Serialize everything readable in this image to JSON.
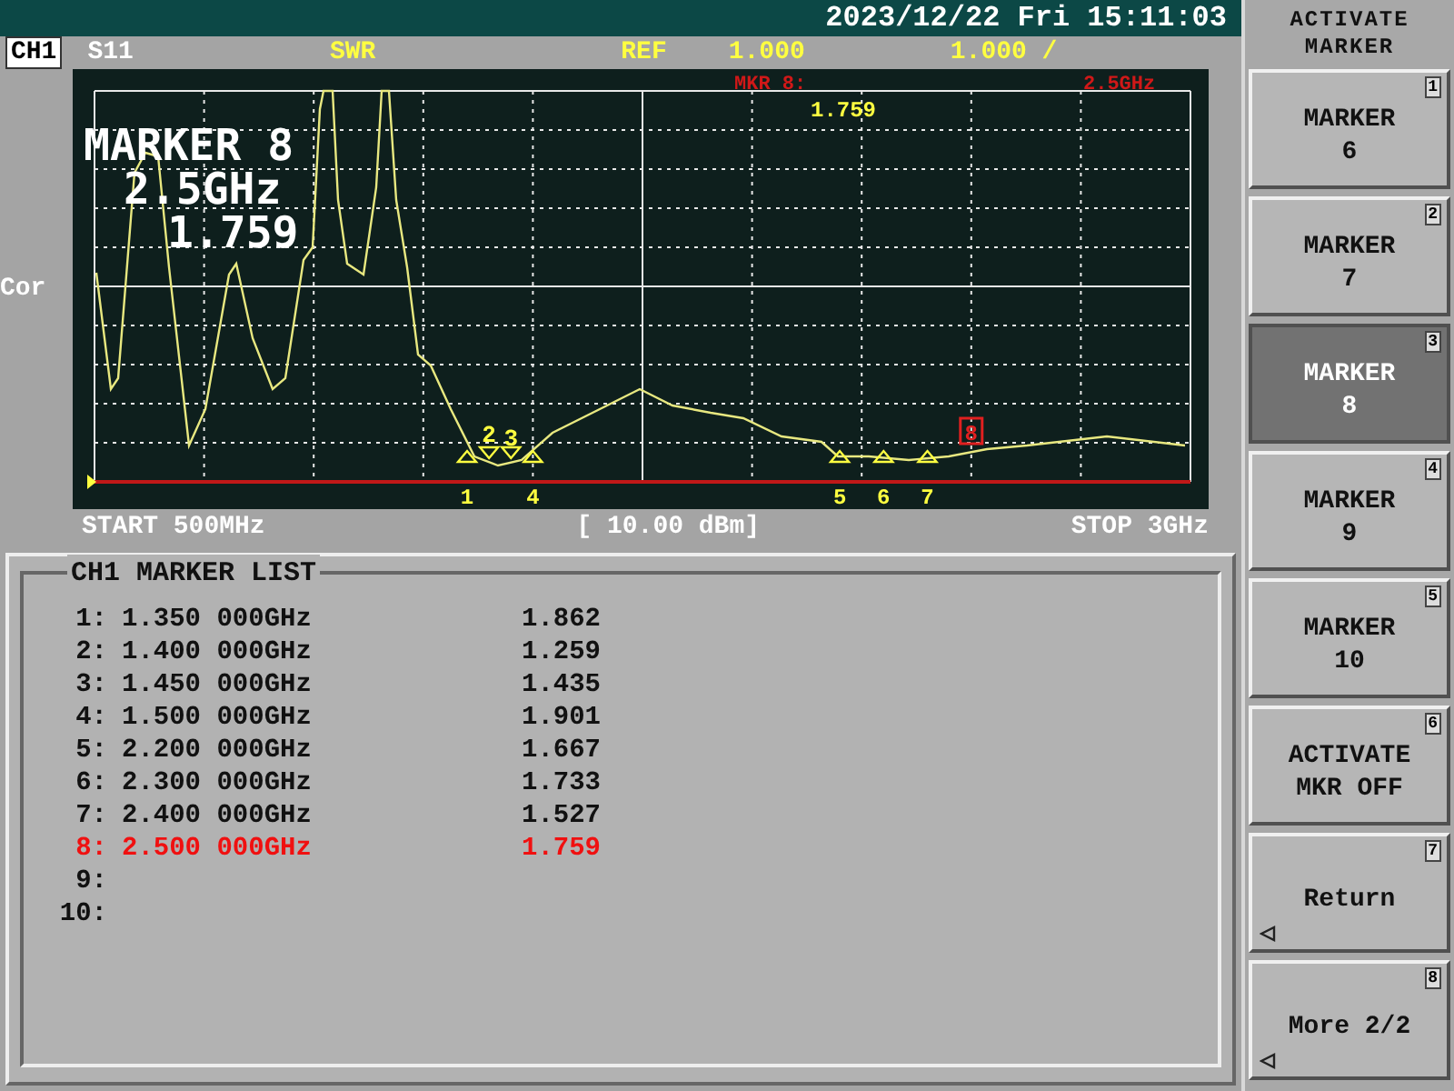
{
  "status_bar": {
    "datetime": "2023/12/22 Fri 15:11:03"
  },
  "channel_header": {
    "channel": "CH1",
    "parameter": "S11",
    "format": "SWR",
    "ref_label": "REF",
    "ref_value": "1.000",
    "scale": "1.000 /"
  },
  "plot": {
    "side_label": "Cor",
    "marker_readout": {
      "title": "MARKER 8",
      "frequency": "2.5GHz",
      "value": "1.759"
    },
    "marker_info": {
      "label": "MKR 8:",
      "value": "1.759",
      "frequency": "2.5GHz"
    },
    "markers": [
      {
        "label": "1",
        "kind": "up"
      },
      {
        "label": "2",
        "kind": "down"
      },
      {
        "label": "3",
        "kind": "down"
      },
      {
        "label": "4",
        "kind": "up"
      },
      {
        "label": "5",
        "kind": "up"
      },
      {
        "label": "6",
        "kind": "up"
      },
      {
        "label": "7",
        "kind": "up"
      },
      {
        "label": "8",
        "kind": "active"
      }
    ],
    "start": "START 500MHz",
    "power": "[ 10.00 dBm]",
    "stop": "STOP 3GHz"
  },
  "marker_list": {
    "title": "CH1 MARKER LIST",
    "rows": [
      {
        "index": "1:",
        "frequency": "1.350 000GHz",
        "value": "1.862",
        "selected": false
      },
      {
        "index": "2:",
        "frequency": "1.400 000GHz",
        "value": "1.259",
        "selected": false
      },
      {
        "index": "3:",
        "frequency": "1.450 000GHz",
        "value": "1.435",
        "selected": false
      },
      {
        "index": "4:",
        "frequency": "1.500 000GHz",
        "value": "1.901",
        "selected": false
      },
      {
        "index": "5:",
        "frequency": "2.200 000GHz",
        "value": "1.667",
        "selected": false
      },
      {
        "index": "6:",
        "frequency": "2.300 000GHz",
        "value": "1.733",
        "selected": false
      },
      {
        "index": "7:",
        "frequency": "2.400 000GHz",
        "value": "1.527",
        "selected": false
      },
      {
        "index": "8:",
        "frequency": "2.500 000GHz",
        "value": "1.759",
        "selected": true
      },
      {
        "index": "9:",
        "selected": false
      },
      {
        "index": "10:",
        "selected": false
      }
    ]
  },
  "softkeys": {
    "title": "ACTIVATE MARKER",
    "keys": [
      {
        "lines": [
          "MARKER",
          "6"
        ],
        "number": "1",
        "selected": false,
        "submenu": false
      },
      {
        "lines": [
          "MARKER",
          "7"
        ],
        "number": "2",
        "selected": false,
        "submenu": false
      },
      {
        "lines": [
          "MARKER",
          "8"
        ],
        "number": "3",
        "selected": true,
        "submenu": false
      },
      {
        "lines": [
          "MARKER",
          "9"
        ],
        "number": "4",
        "selected": false,
        "submenu": false
      },
      {
        "lines": [
          "MARKER",
          "10"
        ],
        "number": "5",
        "selected": false,
        "submenu": false
      },
      {
        "lines": [
          "ACTIVATE",
          "MKR OFF"
        ],
        "number": "6",
        "selected": false,
        "submenu": false
      },
      {
        "lines": [
          "Return"
        ],
        "number": "7",
        "selected": false,
        "submenu": true
      },
      {
        "lines": [
          "More 2/2"
        ],
        "number": "8",
        "selected": false,
        "submenu": true
      }
    ]
  }
}
